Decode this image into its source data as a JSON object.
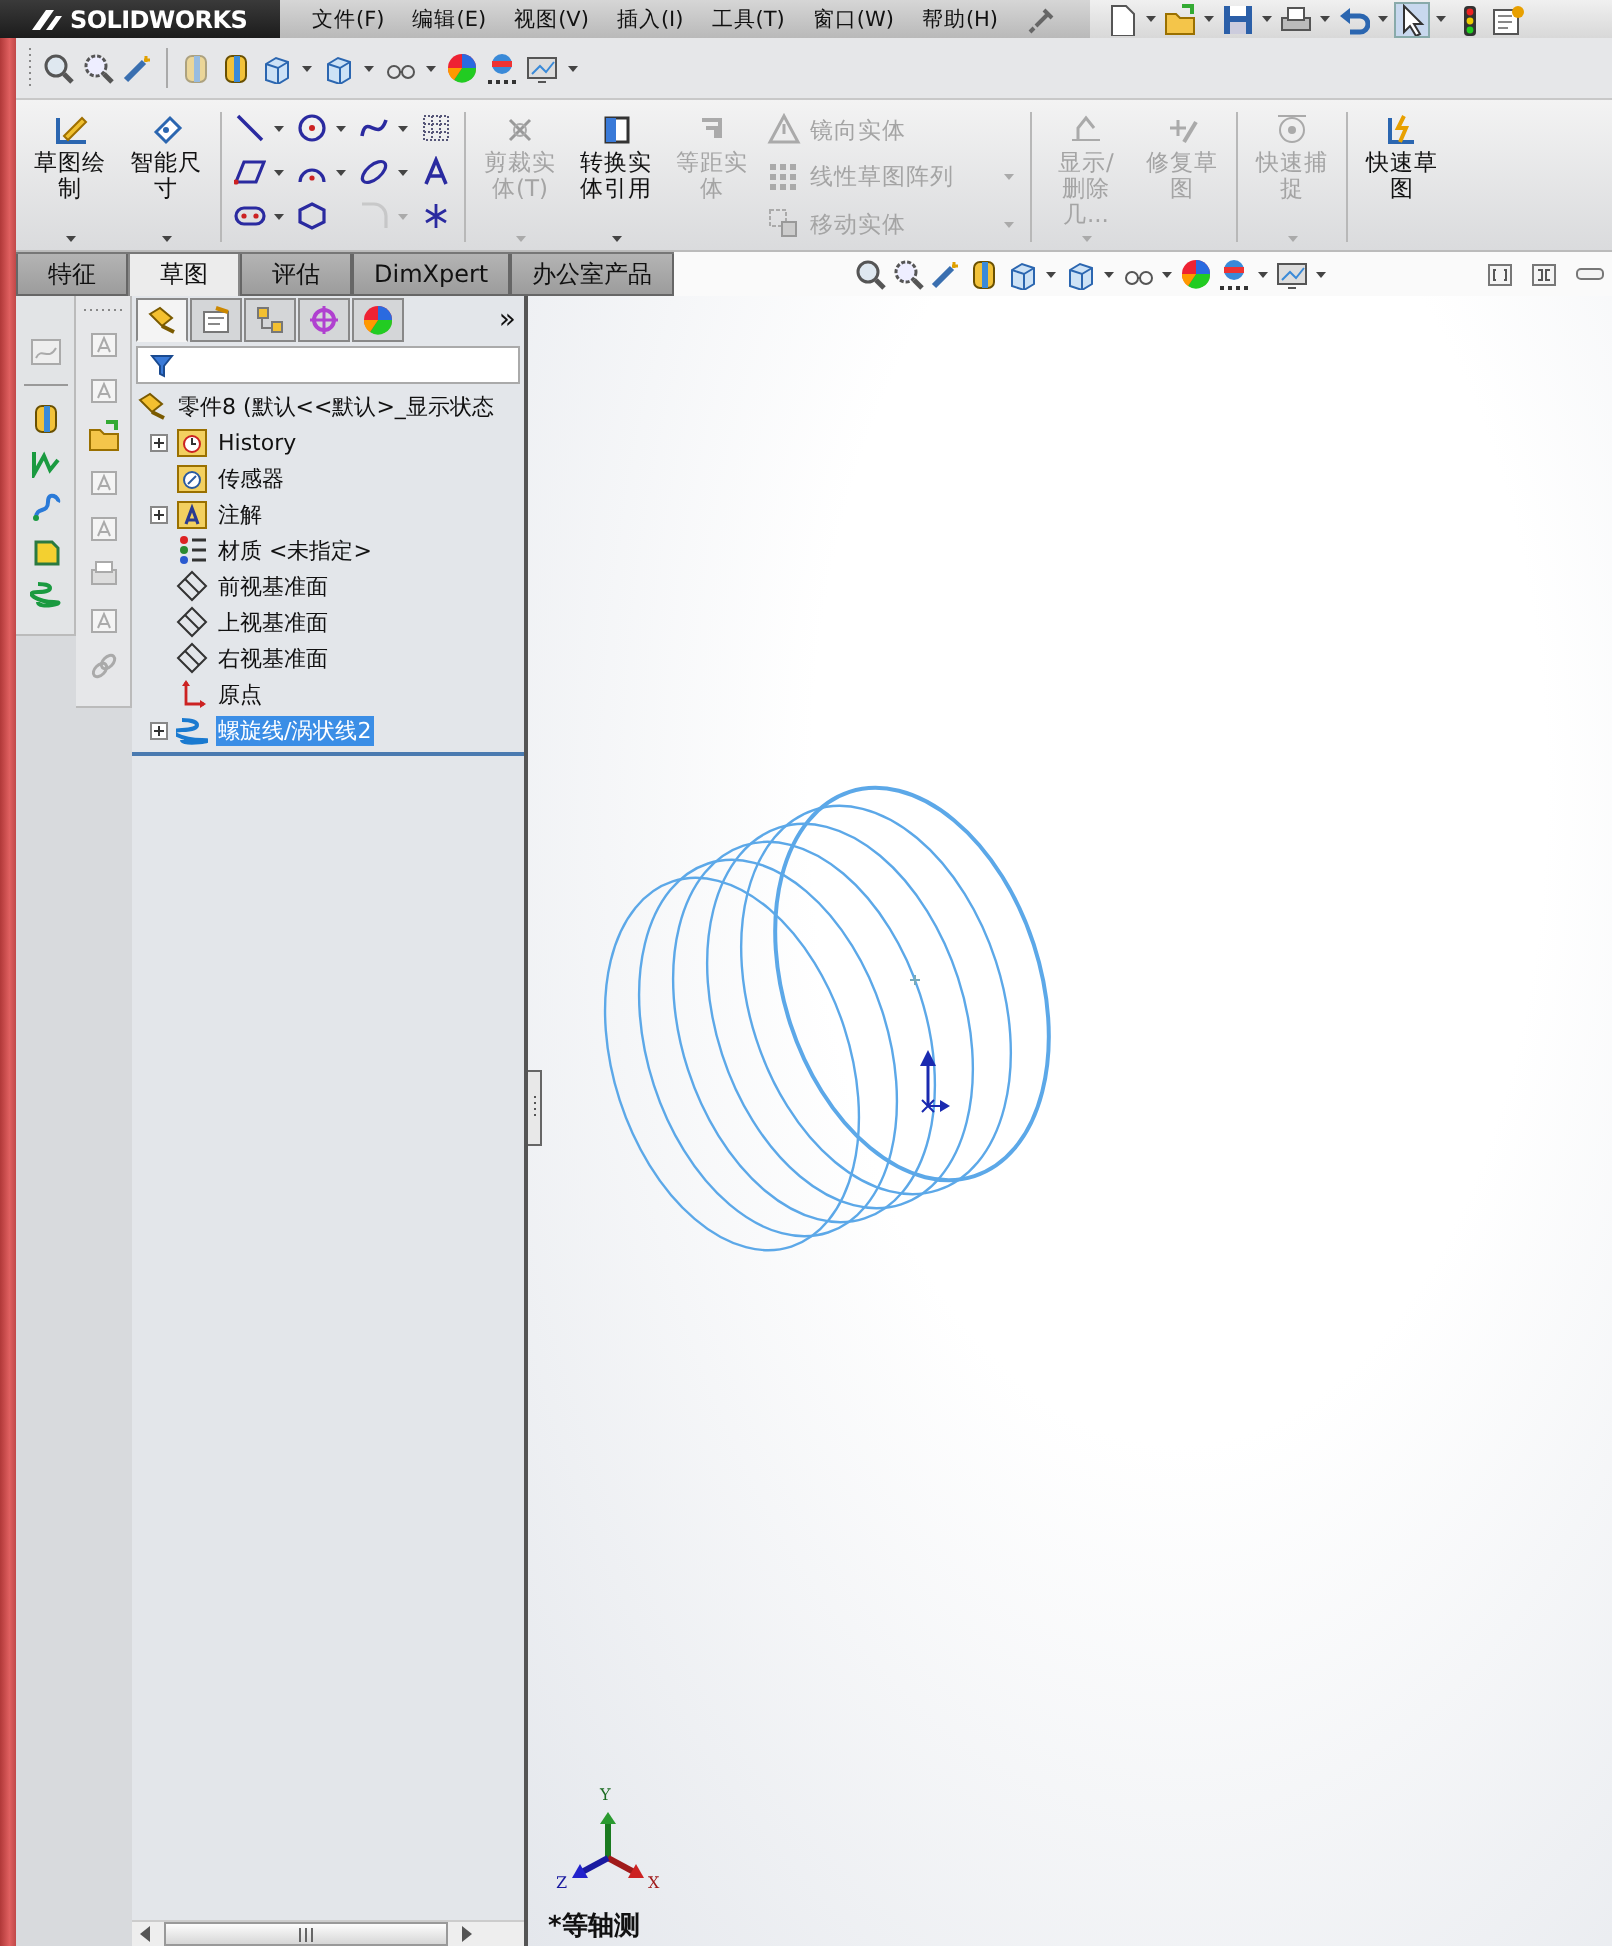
{
  "app": {
    "logo": "SOLIDWORKS",
    "menu": [
      "文件(F)",
      "编辑(E)",
      "视图(V)",
      "插入(I)",
      "工具(T)",
      "窗口(W)",
      "帮助(H)"
    ]
  },
  "ribbon": [
    {
      "kind": "buttons",
      "items": [
        {
          "label": "草图绘制",
          "kind": "large",
          "disabled": false,
          "dropdown": true
        },
        {
          "label": "智能尺寸",
          "kind": "large",
          "disabled": false,
          "dropdown": true
        }
      ]
    },
    {
      "kind": "tools"
    },
    {
      "kind": "buttons",
      "items": [
        {
          "label": "剪裁实体(T)",
          "kind": "large",
          "disabled": true,
          "dropdown": true
        },
        {
          "label": "转换实体引用",
          "kind": "large",
          "disabled": false,
          "dropdown": true
        },
        {
          "label": "等距实体",
          "kind": "large",
          "disabled": true,
          "dropdown": false
        },
        {
          "label": "镜向实体",
          "kind": "small",
          "disabled": true,
          "dropdown": false
        },
        {
          "label": "线性草图阵列",
          "kind": "small",
          "disabled": true,
          "dropdown": true
        },
        {
          "label": "移动实体",
          "kind": "small",
          "disabled": true,
          "dropdown": true
        }
      ]
    },
    {
      "kind": "buttons",
      "items": [
        {
          "label": "显示/删除几...",
          "kind": "large",
          "disabled": true,
          "dropdown": true
        },
        {
          "label": "修复草图",
          "kind": "large",
          "disabled": true,
          "dropdown": false
        }
      ]
    },
    {
      "kind": "buttons",
      "items": [
        {
          "label": "快速捕捉",
          "kind": "large",
          "disabled": true,
          "dropdown": true
        }
      ]
    },
    {
      "kind": "buttons",
      "items": [
        {
          "label": "快速草图",
          "kind": "large",
          "disabled": false,
          "dropdown": false
        }
      ]
    }
  ],
  "tabs": [
    {
      "label": "特征",
      "selected": false
    },
    {
      "label": "草图",
      "selected": true
    },
    {
      "label": "评估",
      "selected": false
    },
    {
      "label": "DimXpert",
      "selected": false
    },
    {
      "label": "办公室产品",
      "selected": false
    }
  ],
  "tree_panel": {
    "tabs": [
      {
        "kind": "feature",
        "selected": true
      },
      {
        "kind": "property",
        "selected": false
      },
      {
        "kind": "config",
        "selected": false
      },
      {
        "kind": "dimxpert",
        "selected": false
      },
      {
        "kind": "display",
        "selected": false
      }
    ],
    "more": "»",
    "root": {
      "label": "零件8  (默认<<默认>_显示状态",
      "children": [
        {
          "label": "History",
          "kind": "history",
          "expanded": false,
          "selected": false
        },
        {
          "label": "传感器",
          "kind": "sensor",
          "selected": false
        },
        {
          "label": "注解",
          "kind": "annotation",
          "expanded": false,
          "selected": false
        },
        {
          "label": "材质 <未指定>",
          "kind": "material",
          "selected": false
        },
        {
          "label": "前视基准面",
          "kind": "plane",
          "selected": false
        },
        {
          "label": "上视基准面",
          "kind": "plane",
          "selected": false
        },
        {
          "label": "右视基准面",
          "kind": "plane",
          "selected": false
        },
        {
          "label": "原点",
          "kind": "origin",
          "selected": false
        },
        {
          "label": "螺旋线/涡状线2",
          "kind": "helix",
          "expanded": false,
          "selected": true
        }
      ]
    }
  },
  "viewport": {
    "triad": {
      "x": "X",
      "y": "Y",
      "z": "Z"
    },
    "view_name": "*等轴测"
  }
}
